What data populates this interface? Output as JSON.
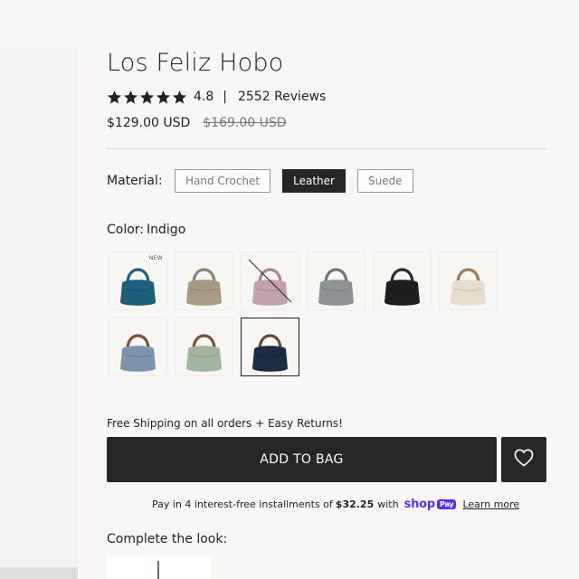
{
  "product": {
    "title": "Los Feliz Hobo",
    "rating_value": "4.8",
    "rating_separator": "|",
    "review_count": "2552 Reviews",
    "stars": 5,
    "price": "$129.00 USD",
    "compare_price": "$169.00 USD"
  },
  "material": {
    "label": "Material:",
    "options": [
      {
        "label": "Hand Crochet",
        "selected": false
      },
      {
        "label": "Leather",
        "selected": true
      },
      {
        "label": "Suede",
        "selected": false
      }
    ]
  },
  "color": {
    "label": "Color:",
    "selected": "Indigo",
    "swatches": [
      {
        "name": "teal",
        "body": "#1f5f7d",
        "strap": "#1f5f7d",
        "badge": "NEW",
        "unavailable": false
      },
      {
        "name": "taupe",
        "body": "#a79b85",
        "strap": "#8e8270",
        "badge": "",
        "unavailable": false
      },
      {
        "name": "mauve",
        "body": "#c3a1ad",
        "strap": "#a98592",
        "badge": "",
        "unavailable": true
      },
      {
        "name": "slate",
        "body": "#8d9294",
        "strap": "#6f7375",
        "badge": "",
        "unavailable": false
      },
      {
        "name": "black",
        "body": "#1e1e1e",
        "strap": "#2a2a2a",
        "badge": "",
        "unavailable": false
      },
      {
        "name": "ecru",
        "body": "#e6ddd0",
        "strap": "#9b7b60",
        "badge": "",
        "unavailable": false
      },
      {
        "name": "blue-grey",
        "body": "#7b93ad",
        "strap": "#7a4f33",
        "badge": "",
        "unavailable": false
      },
      {
        "name": "sage",
        "body": "#a4b5a0",
        "strap": "#7a4f33",
        "badge": "",
        "unavailable": false
      },
      {
        "name": "indigo",
        "body": "#1d2b45",
        "strap": "#6b4a35",
        "badge": "",
        "unavailable": false
      }
    ]
  },
  "shipping_text": "Free Shipping on all orders + Easy Returns!",
  "add_to_bag": "ADD TO BAG",
  "installments": {
    "prefix": "Pay in 4 interest-free installments of",
    "amount": "$32.25",
    "with": "with",
    "brand": "shop",
    "brand_badge": "Pay",
    "learn_more": "Learn more"
  },
  "complete_look": "Complete the look:",
  "icons": {
    "star": "star-icon",
    "wishlist": "heart-icon"
  },
  "colors": {
    "accent": "#262626",
    "shop_pay": "#5a31f4",
    "star": "#222222"
  }
}
